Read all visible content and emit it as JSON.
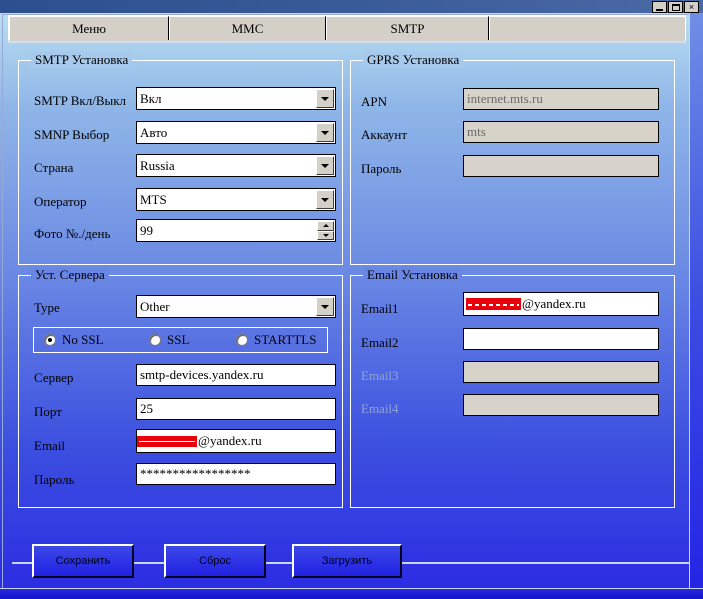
{
  "window": {
    "titlebar_buttons": [
      {
        "name": "minimize",
        "glyph": "minimize-icon"
      },
      {
        "name": "maximize",
        "glyph": "maximize-icon"
      },
      {
        "name": "close",
        "glyph": "close-icon",
        "label": "×"
      }
    ]
  },
  "tabs": [
    {
      "label": "Меню",
      "selected": false
    },
    {
      "label": "MMC",
      "selected": false
    },
    {
      "label": "SMTP",
      "selected": true
    }
  ],
  "smtp_group": {
    "title": "SMTP Установка",
    "fields": [
      {
        "label": "SMTP Вкл/Выкл",
        "value": "Вкл",
        "type": "combo"
      },
      {
        "label": "SMNP Выбор",
        "value": "Авто",
        "type": "combo"
      },
      {
        "label": "Страна",
        "value": "Russia",
        "type": "combo"
      },
      {
        "label": "Оператор",
        "value": "MTS",
        "type": "combo"
      },
      {
        "label": "Фото №./день",
        "value": "99",
        "type": "spinner"
      }
    ]
  },
  "gprs_group": {
    "title": "GPRS Установка",
    "fields": [
      {
        "label": "APN",
        "value": "internet.mts.ru",
        "disabled": true
      },
      {
        "label": "Аккаунт",
        "value": "mts",
        "disabled": true
      },
      {
        "label": "Пароль",
        "value": "",
        "disabled": true
      }
    ]
  },
  "server_group": {
    "title": "Уст. Сервера",
    "type_label": "Type",
    "type_value": "Other",
    "ssl_options": [
      {
        "label": "No SSL",
        "checked": true
      },
      {
        "label": "SSL",
        "checked": false
      },
      {
        "label": "STARTTLS",
        "checked": false
      }
    ],
    "fields": [
      {
        "label": "Сервер",
        "value": "smtp-devices.yandex.ru"
      },
      {
        "label": "Порт",
        "value": "25"
      },
      {
        "label": "Email",
        "value": "@yandex.ru",
        "redacted": true
      },
      {
        "label": "Пароль",
        "value": "*****************"
      }
    ]
  },
  "email_group": {
    "title": "Email Установка",
    "fields": [
      {
        "label": "Email1",
        "value": "@yandex.ru",
        "redacted": true,
        "disabled": false
      },
      {
        "label": "Email2",
        "value": "",
        "redacted": false,
        "disabled": false
      },
      {
        "label": "Email3",
        "value": "",
        "redacted": false,
        "disabled": true
      },
      {
        "label": "Email4",
        "value": "",
        "redacted": false,
        "disabled": true
      }
    ]
  },
  "buttons": [
    {
      "label": "Сохранить"
    },
    {
      "label": "Сброс"
    },
    {
      "label": "Загрузить"
    }
  ],
  "colors": {
    "redaction": "#e8000b",
    "titlebar": "#2c4f8e",
    "control_face": "#d4d0c8",
    "disabled_field": "#d7d3cb",
    "accent_blue": "#2222e2"
  }
}
